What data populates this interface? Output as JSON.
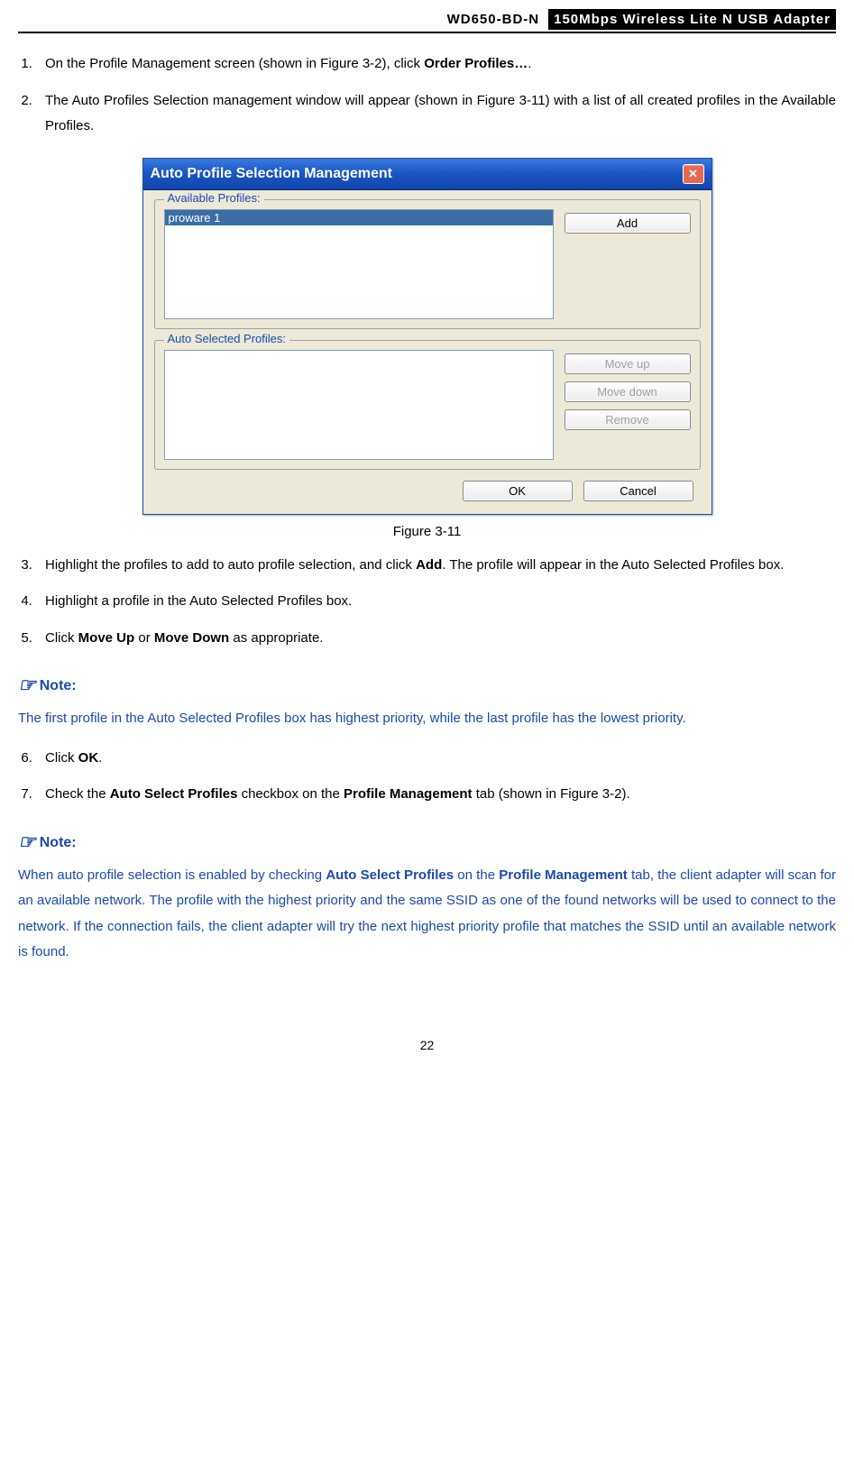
{
  "header": {
    "product": "WD650-BD-N",
    "desc": "150Mbps Wireless Lite N USB Adapter"
  },
  "steps_a": [
    {
      "pre": "On the Profile Management screen (shown in Figure 3-2), click ",
      "bold": "Order Profiles…",
      "post": "."
    },
    {
      "pre": "The Auto Profiles Selection management window will appear (shown in Figure 3-11) with a list of all created profiles in the Available Profiles.",
      "bold": "",
      "post": ""
    }
  ],
  "figure_caption": "Figure 3-11",
  "steps_b": [
    {
      "pre": "Highlight the profiles to add to auto profile selection, and click ",
      "bold": "Add",
      "post": ". The profile will appear in the Auto Selected Profiles box."
    },
    {
      "pre": "Highlight a profile in the Auto Selected Profiles box.",
      "bold": "",
      "post": ""
    },
    {
      "pre": "Click ",
      "bold": "Move Up",
      "mid": " or ",
      "bold2": "Move Down",
      "post": " as appropriate."
    }
  ],
  "note1_heading": "Note:",
  "note1_body": "The first profile in the Auto Selected Profiles box has highest priority, while the last profile has the lowest priority.",
  "steps_c": [
    {
      "pre": "Click ",
      "bold": "OK",
      "post": "."
    },
    {
      "pre": "Check the ",
      "bold": "Auto Select Profiles",
      "mid": " checkbox on the ",
      "bold2": "Profile Management",
      "post": " tab (shown in Figure 3-2)."
    }
  ],
  "note2_heading": "Note:",
  "note2_body_parts": {
    "p0": "When auto profile selection is enabled by checking ",
    "b0": "Auto Select Profiles",
    "p1": " on the ",
    "b1": "Profile Management",
    "p2": " tab, the client adapter will scan for an available network. The profile with the highest priority and the same SSID as one of the found networks will be used to connect to the network. If the connection fails, the client adapter will try the next highest priority profile that matches the SSID until an available network is found."
  },
  "dialog": {
    "title": "Auto Profile Selection Management",
    "group1": "Available Profiles:",
    "group2": "Auto Selected Profiles:",
    "available_item": "proware 1",
    "btn_add": "Add",
    "btn_moveup": "Move up",
    "btn_movedown": "Move down",
    "btn_remove": "Remove",
    "btn_ok": "OK",
    "btn_cancel": "Cancel"
  },
  "page_num": "22"
}
